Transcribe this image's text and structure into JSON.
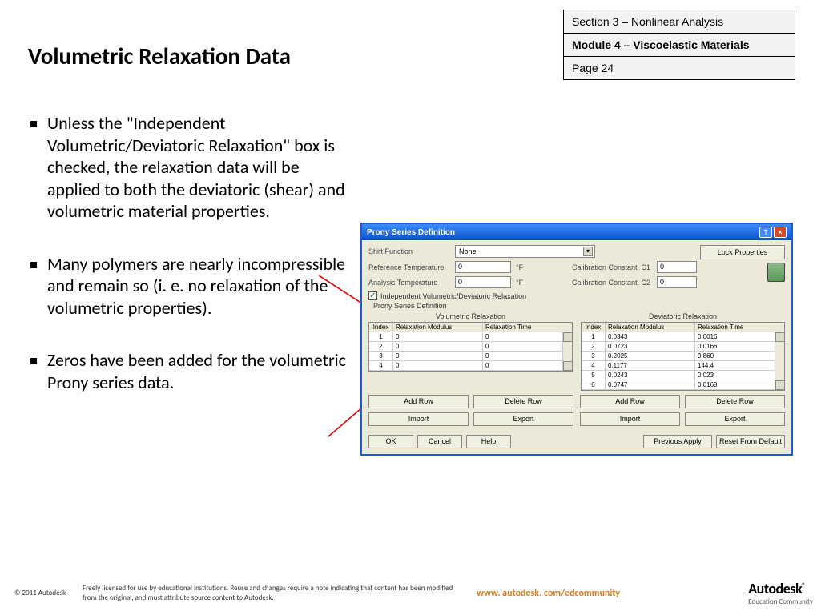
{
  "title": "Volumetric Relaxation Data",
  "info": {
    "section": "Section 3 – Nonlinear Analysis",
    "module": "Module 4 – Viscoelastic Materials",
    "page": "Page 24"
  },
  "bullets": [
    "Unless the \"Independent Volumetric/Deviatoric Relaxation\" box is checked, the relaxation data will be applied to both the deviatoric (shear) and volumetric material properties.",
    "Many polymers are nearly incompressible and remain so (i. e. no relaxation of the volumetric properties).",
    "Zeros have been added for the volumetric Prony series data."
  ],
  "dialog": {
    "title": "Prony Series Definition",
    "lock": "Lock Properties",
    "shift_label": "Shift Function",
    "shift_value": "None",
    "ref_label": "Reference Temperature",
    "ref_value": "0",
    "ref_unit": "°F",
    "anal_label": "Analysis Temperature",
    "anal_value": "0",
    "anal_unit": "°F",
    "c1_label": "Calibration Constant, C1",
    "c1_value": "0",
    "c2_label": "Calibration Constant, C2",
    "c2_value": "0",
    "checkbox": "Independent Volumetric/Deviatoric Relaxation",
    "psd": "Prony Series Definition",
    "vol_title": "Volumetric Relaxation",
    "dev_title": "Deviatoric Relaxation",
    "hdr_index": "Index",
    "hdr_mod": "Relaxation Modulus",
    "hdr_time": "Relaxation Time",
    "vol_rows": [
      {
        "i": "1",
        "m": "0",
        "t": "0"
      },
      {
        "i": "2",
        "m": "0",
        "t": "0"
      },
      {
        "i": "3",
        "m": "0",
        "t": "0"
      },
      {
        "i": "4",
        "m": "0",
        "t": "0"
      }
    ],
    "dev_rows": [
      {
        "i": "1",
        "m": "0.0343",
        "t": "0.0016"
      },
      {
        "i": "2",
        "m": "0.0723",
        "t": "0.0166"
      },
      {
        "i": "3",
        "m": "0.2025",
        "t": "9.860"
      },
      {
        "i": "4",
        "m": "0.1177",
        "t": "144.4"
      },
      {
        "i": "5",
        "m": "0.0243",
        "t": "0.023"
      },
      {
        "i": "6",
        "m": "0.0747",
        "t": "0.0168"
      }
    ],
    "add_row": "Add Row",
    "delete_row": "Delete Row",
    "import": "Import",
    "export": "Export",
    "ok": "OK",
    "cancel": "Cancel",
    "help": "Help",
    "prev": "Previous Apply",
    "reset": "Reset From Default"
  },
  "footer": {
    "copyright": "© 2011 Autodesk",
    "license": "Freely licensed for use by educational institutions. Reuse and changes require a note indicating that content has been modified from the original, and must attribute source content to Autodesk.",
    "edlink": "www. autodesk. com/edcommunity",
    "brand": "Autodesk",
    "brand_sub": "Education Community"
  }
}
